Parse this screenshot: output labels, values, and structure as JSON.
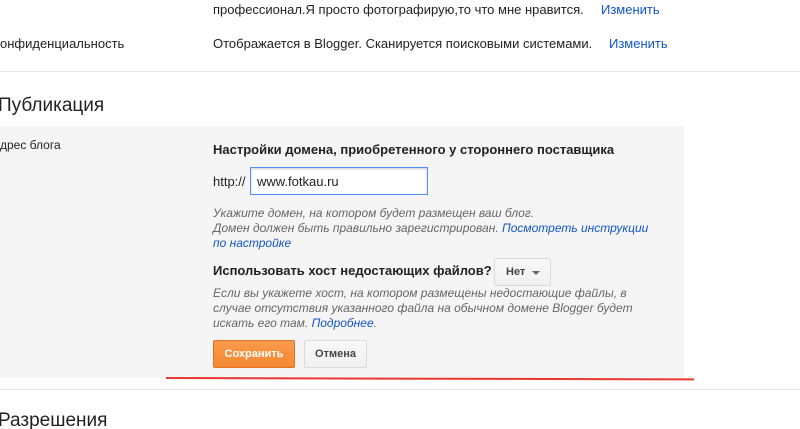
{
  "profile_row": {
    "text": "профессионал.Я просто фотографирую,то что мне нравится.",
    "edit_link": "Изменить"
  },
  "privacy_row": {
    "label": "онфиденциальность",
    "text": "Отображается в Blogger. Сканируется поисковыми системами.",
    "edit_link": "Изменить"
  },
  "publishing_section": {
    "title": "Публикация",
    "blog_address_label": "дрес блога",
    "panel": {
      "title": "Настройки домена, приобретенного у стороннего поставщика",
      "protocol_prefix": "http://",
      "domain_value": "www.fotkau.ru",
      "hint_line1": "Укажите домен, на котором будет размещен ваш блог.",
      "hint_line2": "Домен должен быть правильно зарегистрирован.",
      "hint_link": "Посмотреть инструкции по настройке",
      "missing_files_question": "Использовать хост недостающих файлов?",
      "missing_files_selected": "Нет",
      "missing_files_hint": "Если вы укажете хост, на котором размещены недостающие файлы, в случае отсутствия указанного файла на обычном домене Blogger будет искать его там.",
      "missing_files_link": "Подробнее",
      "save_label": "Сохранить",
      "cancel_label": "Отмена"
    }
  },
  "permissions_section": {
    "title": "Разрешения"
  },
  "colors": {
    "link": "#1155cc",
    "save_button": "#f48832",
    "annotation_line": "#e8382f",
    "panel_background": "#f5f5f5"
  }
}
